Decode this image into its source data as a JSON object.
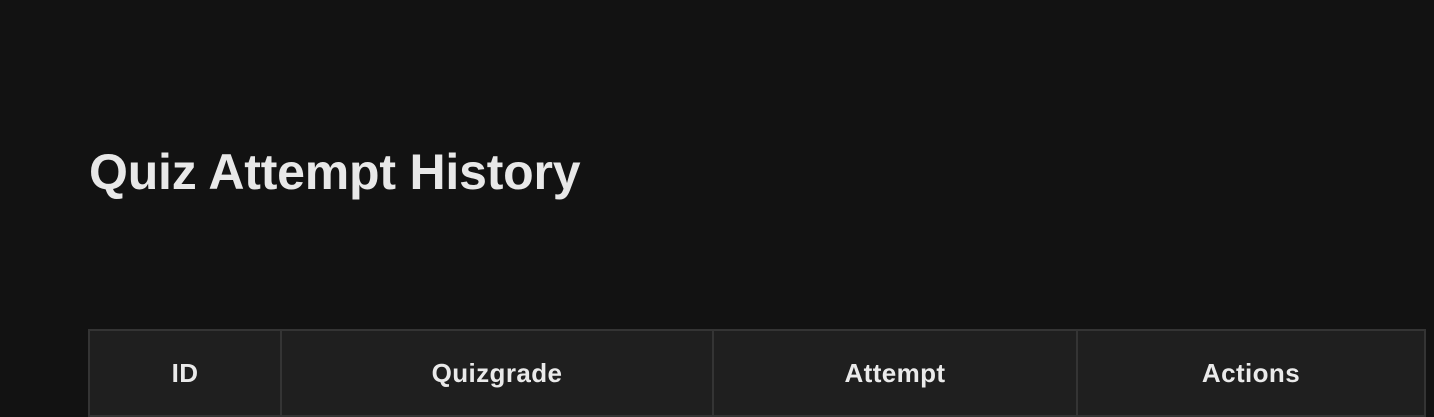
{
  "page": {
    "title": "Quiz Attempt History"
  },
  "table": {
    "columns": [
      "ID",
      "Quizgrade",
      "Attempt",
      "Actions"
    ]
  },
  "colors": {
    "background": "#121212",
    "header_cell": "#1f1f1f",
    "border": "#343434",
    "text": "#e8e8e8"
  }
}
